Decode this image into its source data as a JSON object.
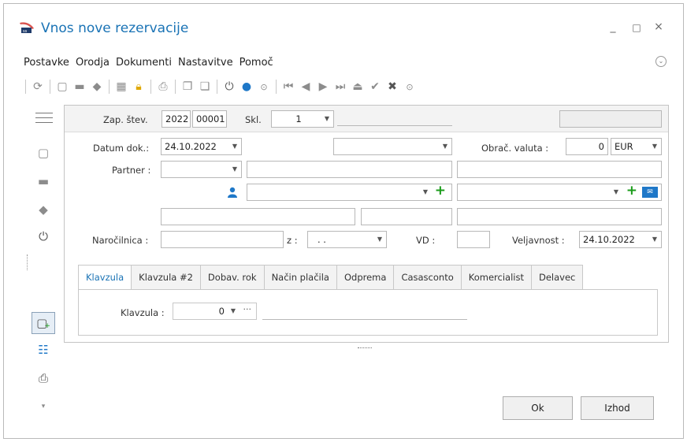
{
  "window": {
    "title": "Vnos nove rezervacije",
    "minimize": "_",
    "maximize": "□",
    "close": "×"
  },
  "menu": [
    "Postavke",
    "Orodja",
    "Dokumenti",
    "Nastavitve",
    "Pomoč"
  ],
  "header": {
    "zap_label": "Zap. štev.",
    "year_value": "2022",
    "number_value": "00001",
    "skl_label": "Skl.",
    "skl_value": "1"
  },
  "form": {
    "datum_label": "Datum dok.:",
    "datum_value": "24.10.2022",
    "valuta_label": "Obrač. valuta :",
    "valuta_amount": "0",
    "valuta_currency": "EUR",
    "partner_label": "Partner :",
    "narocilnica_label": "Naročilnica :",
    "z_label": "z :",
    "z_value": ". .",
    "vd_label": "VD :",
    "veljavnost_label": "Veljavnost :",
    "veljavnost_value": "24.10.2022"
  },
  "tabs": [
    "Klavzula",
    "Klavzula #2",
    "Dobav. rok",
    "Način plačila",
    "Odprema",
    "Casasconto",
    "Komercialist",
    "Delavec"
  ],
  "klavzula": {
    "label": "Klavzula :",
    "value": "0"
  },
  "buttons": {
    "ok": "Ok",
    "exit": "Izhod"
  },
  "colors": {
    "accent": "#1a73b5",
    "green_plus": "#1a9b1a"
  }
}
